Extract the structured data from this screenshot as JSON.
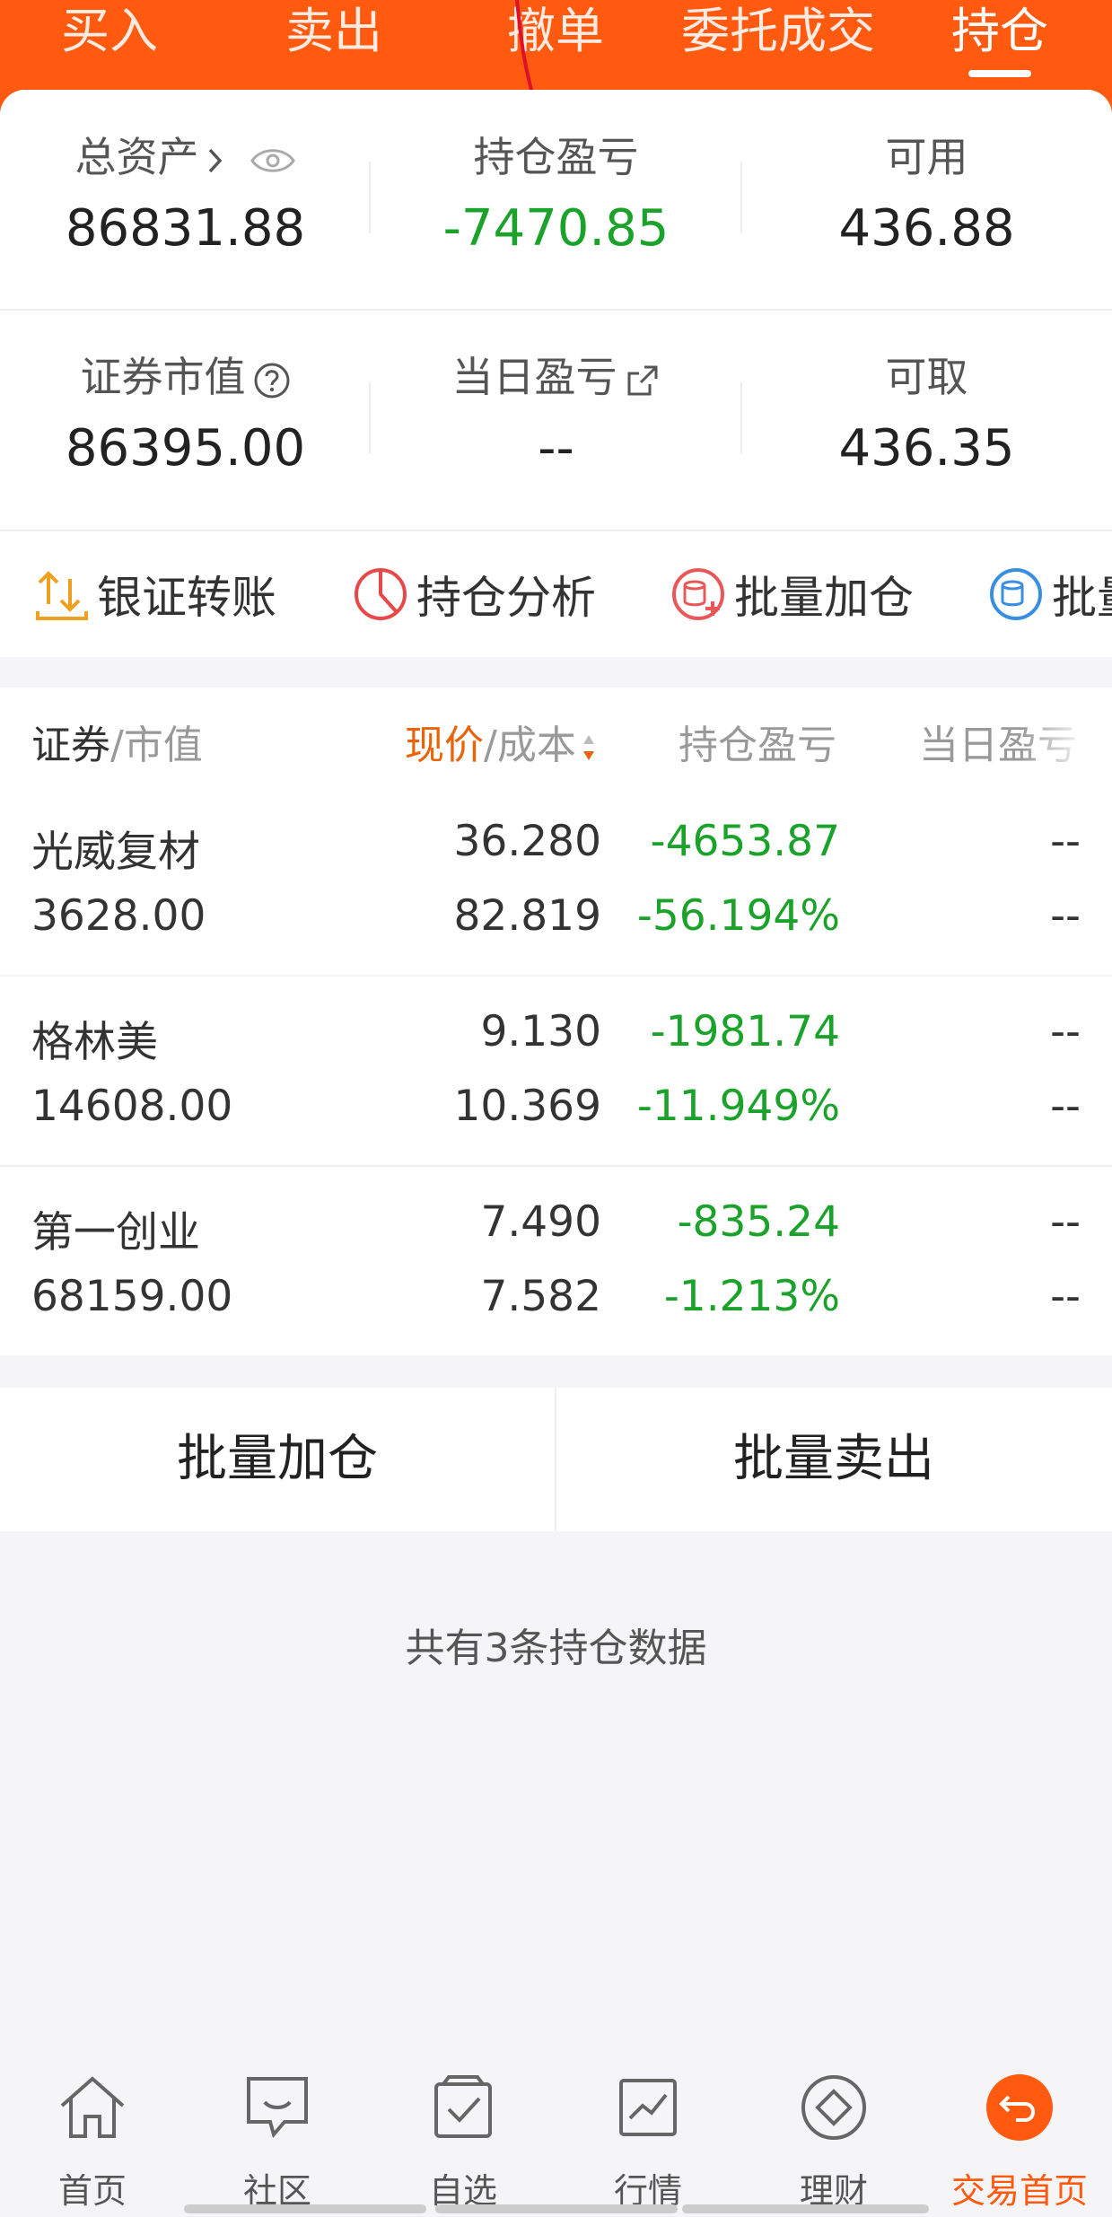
{
  "header": {
    "tabs": [
      {
        "label": "买入"
      },
      {
        "label": "卖出"
      },
      {
        "label": "撤单"
      },
      {
        "label": "委托成交"
      },
      {
        "label": "持仓"
      }
    ],
    "active_tab": "持仓"
  },
  "summary_cards": {
    "total_assets": {
      "label": "总资产",
      "value": "86831.88"
    },
    "position_pnl": {
      "label": "持仓盈亏",
      "value": "-7470.85"
    },
    "available": {
      "label": "可用",
      "value": "436.88"
    },
    "market_value": {
      "label": "证券市值",
      "value": "86395.00"
    },
    "daily_pnl": {
      "label": "当日盈亏",
      "value": "--"
    },
    "withdrawable": {
      "label": "可取",
      "value": "436.35"
    }
  },
  "shortcuts": [
    {
      "label": "银证转账",
      "icon": "transfer-icon"
    },
    {
      "label": "持仓分析",
      "icon": "pie-chart-icon"
    },
    {
      "label": "批量加仓",
      "icon": "batch-add-icon"
    },
    {
      "label": "批量",
      "icon": "batch-icon"
    }
  ],
  "table": {
    "headers": {
      "security": "证券",
      "market_value": "/市值",
      "price": "现价",
      "cost": "/成本",
      "pnl": "持仓盈亏",
      "daily": "当日盈亏"
    },
    "rows": [
      {
        "name": "光威复材",
        "market_value": "3628.00",
        "price": "36.280",
        "cost": "82.819",
        "pnl": "-4653.87",
        "pnl_pct": "-56.194%",
        "daily": "--",
        "daily_pct": "--"
      },
      {
        "name": "格林美",
        "market_value": "14608.00",
        "price": "9.130",
        "cost": "10.369",
        "pnl": "-1981.74",
        "pnl_pct": "-11.949%",
        "daily": "--",
        "daily_pct": "--"
      },
      {
        "name": "第一创业",
        "market_value": "68159.00",
        "price": "7.490",
        "cost": "7.582",
        "pnl": "-835.24",
        "pnl_pct": "-1.213%",
        "daily": "--",
        "daily_pct": "--"
      }
    ]
  },
  "actions": {
    "batch_add": "批量加仓",
    "batch_sell": "批量卖出"
  },
  "footer_summary": "共有3条持仓数据",
  "bottom_nav": [
    {
      "label": "首页",
      "icon": "home-icon"
    },
    {
      "label": "社区",
      "icon": "community-icon"
    },
    {
      "label": "自选",
      "icon": "watchlist-icon"
    },
    {
      "label": "行情",
      "icon": "market-icon"
    },
    {
      "label": "理财",
      "icon": "wealth-icon"
    },
    {
      "label": "交易首页",
      "icon": "trade-home-icon"
    }
  ],
  "colors": {
    "brand": "#ff5a0f",
    "loss": "#1aa22a",
    "accent": "#e8630a"
  }
}
